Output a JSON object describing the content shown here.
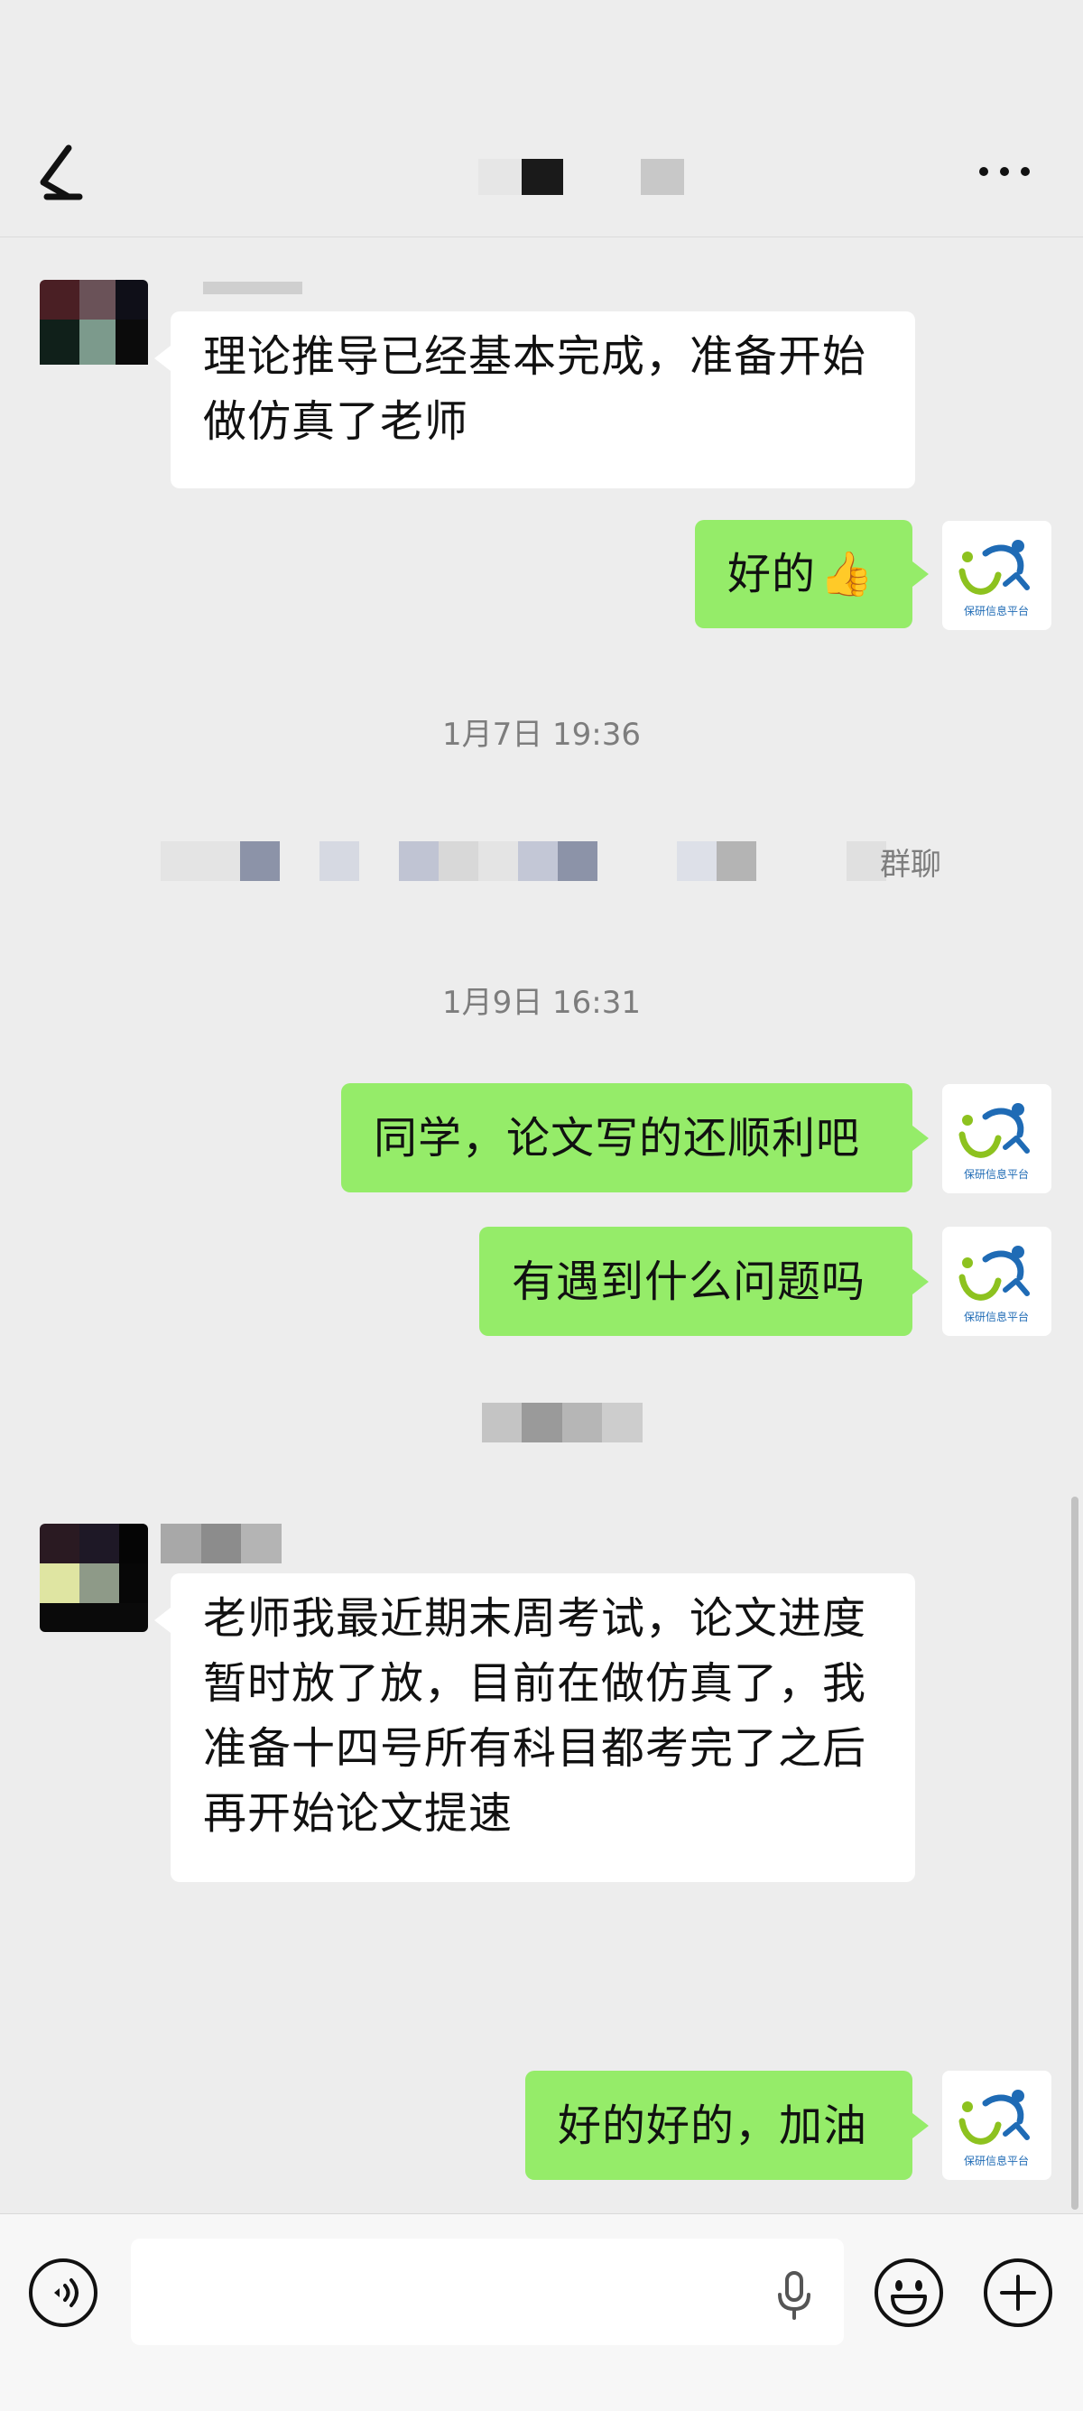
{
  "header": {
    "back_icon": "chevron-left-icon",
    "more_icon": "more-dots-icon"
  },
  "messages": {
    "m1": {
      "text_line1": "理论推导已经基本完成，准备开始",
      "text_line2": "做仿真了老师"
    },
    "m2": {
      "text": "好的",
      "emoji": "👍"
    },
    "time1": "1月7日 19:36",
    "system_suffix": "群聊",
    "time2": "1月9日 16:31",
    "m3": {
      "text": "同学，论文写的还顺利吧"
    },
    "m4": {
      "text": "有遇到什么问题吗"
    },
    "m5": {
      "line1": "老师我最近期末周考试，论文进度",
      "line2": "暂时放了放，目前在做仿真了，我",
      "line3": "准备十四号所有科目都考完了之后",
      "line4": "再开始论文提速"
    },
    "m6": {
      "text": "好的好的，加油"
    }
  },
  "sender_avatar": {
    "logo_text": "保研信息平台"
  },
  "input_bar": {
    "voice_icon": "voice-mode-icon",
    "mic_icon": "microphone-icon",
    "emoji_icon": "emoji-icon",
    "plus_icon": "plus-icon",
    "placeholder": ""
  },
  "colors": {
    "background": "#ededed",
    "out_bubble": "#95ec69",
    "in_bubble": "#ffffff",
    "logo_green": "#8dc21f",
    "logo_blue": "#1f6bb5"
  }
}
